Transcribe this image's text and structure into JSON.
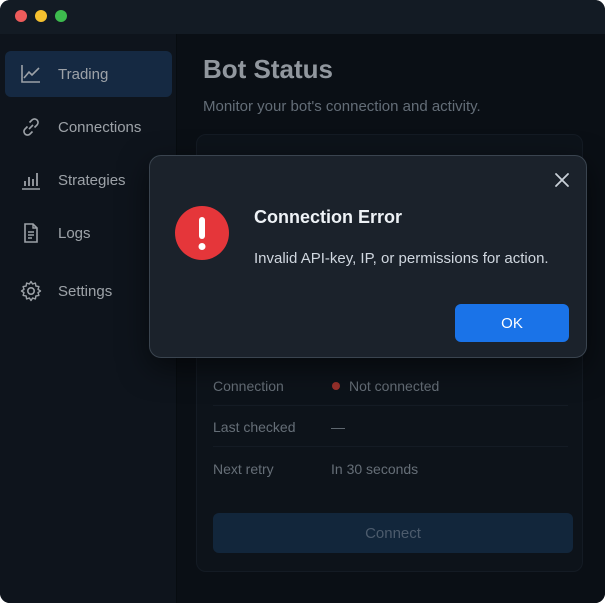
{
  "sidebar": {
    "items": [
      {
        "label": "Trading",
        "icon": "trend-chart-icon",
        "active": true
      },
      {
        "label": "Connections",
        "icon": "link-icon"
      },
      {
        "label": "Strategies",
        "icon": "bar-chart-icon"
      },
      {
        "label": "Logs",
        "icon": "document-icon"
      },
      {
        "label": "Settings",
        "icon": "gear-icon"
      }
    ]
  },
  "main": {
    "title": "Bot Status",
    "subtitle": "Monitor your bot's connection and activity.",
    "status": {
      "rows": [
        {
          "key": "Connection",
          "value": "Not connected",
          "status_color": "#d6453d"
        },
        {
          "key": "Last checked",
          "value": "—"
        },
        {
          "key": "Next retry",
          "value": "In 30 seconds"
        }
      ],
      "connect_label": "Connect"
    }
  },
  "dialog": {
    "title": "Connection Error",
    "message": "Invalid API-key, IP, or permissions for action.",
    "ok_label": "OK",
    "icon": "error-icon"
  },
  "colors": {
    "accent": "#1a73e8",
    "error": "#e5363a",
    "background": "#0f161e"
  }
}
